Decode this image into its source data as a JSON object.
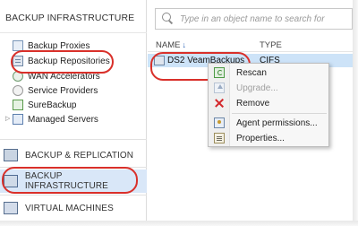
{
  "left_pane": {
    "title": "BACKUP INFRASTRUCTURE",
    "tree": [
      {
        "label": "Backup Proxies",
        "icon": "proxy-icon"
      },
      {
        "label": "Backup Repositories",
        "icon": "repository-icon",
        "highlighted": true
      },
      {
        "label": "WAN Accelerators",
        "icon": "wan-accelerator-icon"
      },
      {
        "label": "Service Providers",
        "icon": "service-provider-icon"
      },
      {
        "label": "SureBackup",
        "icon": "surebackup-icon"
      },
      {
        "label": "Managed Servers",
        "icon": "managed-servers-icon",
        "expandable": true
      }
    ],
    "expander_glyph": "▷"
  },
  "nav": {
    "items": [
      {
        "label": "BACKUP & REPLICATION",
        "icon": "backup-replication-icon"
      },
      {
        "label": "BACKUP INFRASTRUCTURE",
        "icon": "backup-infrastructure-icon",
        "selected": true
      },
      {
        "label": "VIRTUAL MACHINES",
        "icon": "virtual-machines-icon"
      }
    ]
  },
  "right_pane": {
    "search_placeholder": "Type in an object name to search for",
    "columns": [
      {
        "label": "NAME",
        "sort": "↓"
      },
      {
        "label": "TYPE"
      }
    ],
    "rows": [
      {
        "name": "DS2 VeamBackups",
        "type": "CIFS"
      }
    ]
  },
  "context_menu": {
    "items": [
      {
        "label": "Rescan",
        "icon": "rescan-icon",
        "enabled": true
      },
      {
        "label": "Upgrade...",
        "icon": "upgrade-icon",
        "enabled": false
      },
      {
        "label": "Remove",
        "icon": "remove-icon",
        "enabled": true
      },
      {
        "label": "Agent permissions...",
        "icon": "agent-permissions-icon",
        "enabled": true
      },
      {
        "label": "Properties...",
        "icon": "properties-icon",
        "enabled": true
      }
    ]
  },
  "colors": {
    "selection": "#cde3f8",
    "nav_selected": "#d9e7f8",
    "annotation_red": "#d9302a",
    "sort_arrow": "#2b64b8"
  }
}
